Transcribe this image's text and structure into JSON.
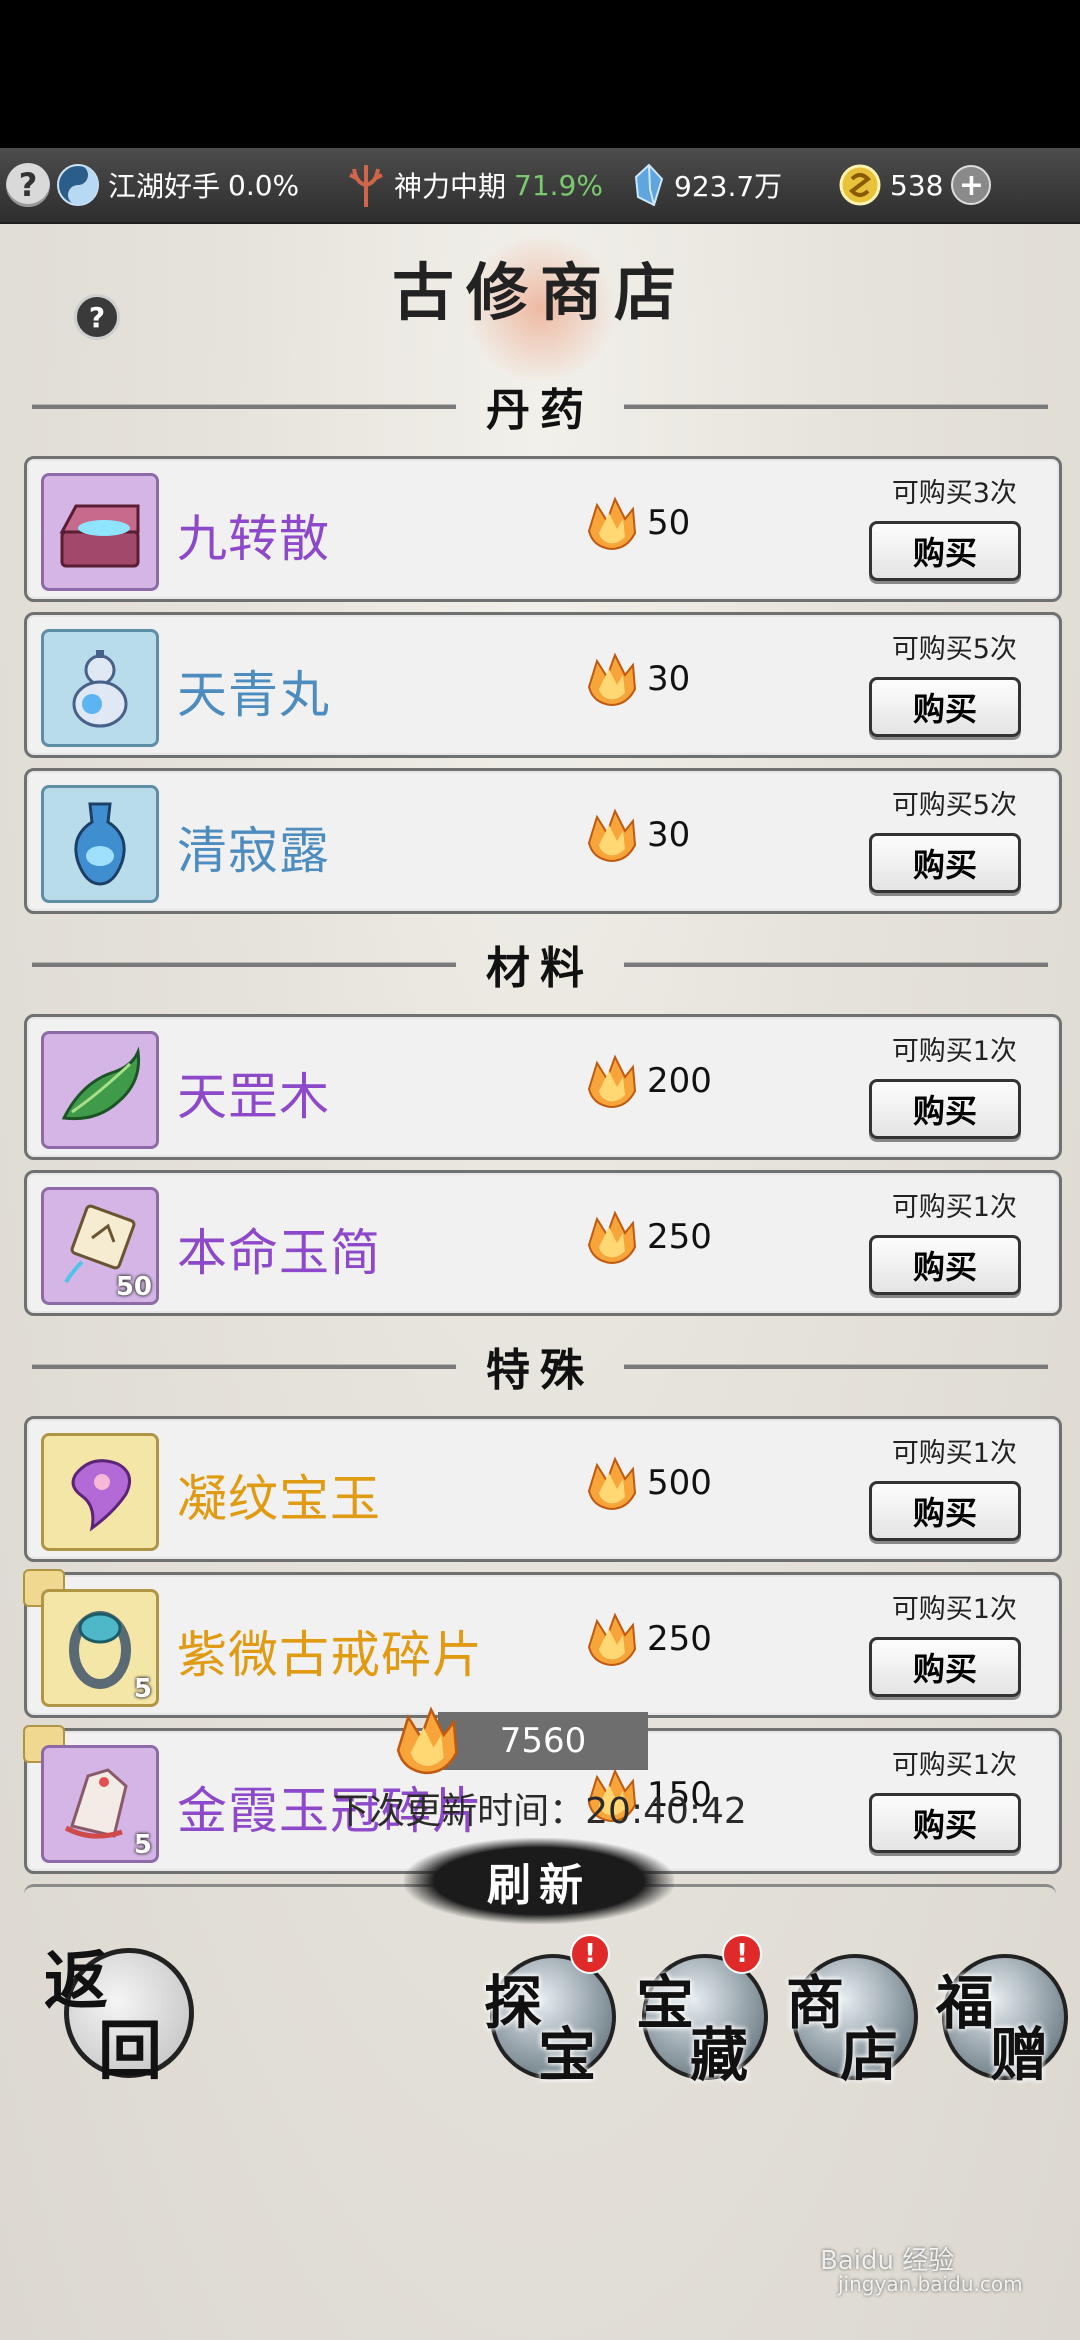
{
  "topbar": {
    "help": "?",
    "rank_label": "江湖好手",
    "rank_value": "0.0%",
    "power_label": "神力中期",
    "power_value": "71.9%",
    "spirit_value": "923.7万",
    "coins_value": "538",
    "add_symbol": "+"
  },
  "page": {
    "title": "古修商店",
    "help": "?"
  },
  "sections": {
    "s1": "丹药",
    "s2": "材料",
    "s3": "特殊"
  },
  "buy_label": "购买",
  "items": [
    {
      "name": "九转散",
      "price": "50",
      "limit": "可购买3次",
      "color": "purple",
      "icon": "treasure-chest-icon"
    },
    {
      "name": "天青丸",
      "price": "30",
      "limit": "可购买5次",
      "color": "blue",
      "icon": "gourd-icon"
    },
    {
      "name": "清寂露",
      "price": "30",
      "limit": "可购买5次",
      "color": "blue",
      "icon": "potion-flask-icon"
    },
    {
      "name": "天罡木",
      "price": "200",
      "limit": "可购买1次",
      "color": "purple",
      "icon": "green-leaf-wood-icon"
    },
    {
      "name": "本命玉简",
      "price": "250",
      "limit": "可购买1次",
      "color": "purple",
      "icon": "jade-slip-icon",
      "qty": "50"
    },
    {
      "name": "凝纹宝玉",
      "price": "500",
      "limit": "可购买1次",
      "color": "gold",
      "icon": "pink-jade-icon"
    },
    {
      "name": "紫微古戒碎片",
      "price": "250",
      "limit": "可购买1次",
      "color": "gold",
      "icon": "ring-fragment-icon",
      "qty": "5"
    },
    {
      "name": "金霞玉冠碎片",
      "price": "150",
      "limit": "可购买1次",
      "color": "gold",
      "icon": "crown-fragment-icon",
      "qty": "5"
    }
  ],
  "footer": {
    "balance": "7560",
    "next_refresh": "下次更新时间：20:40:42",
    "refresh": "刷新"
  },
  "nav": {
    "back_1": "返",
    "back_2": "回",
    "explore_1": "探",
    "explore_2": "宝",
    "treasure_1": "宝",
    "treasure_2": "藏",
    "shop_1": "商",
    "shop_2": "店",
    "gift_1": "福",
    "gift_2": "赠",
    "badge": "!"
  },
  "watermark": {
    "line1": "Baidu 经验",
    "line2": "jingyan.baidu.com"
  },
  "colors": {
    "purple": "#8d49c9",
    "blue": "#4d8cbf",
    "gold": "#e09b13",
    "badge_red": "#e02a2a",
    "percent_green": "#7bc96f"
  }
}
